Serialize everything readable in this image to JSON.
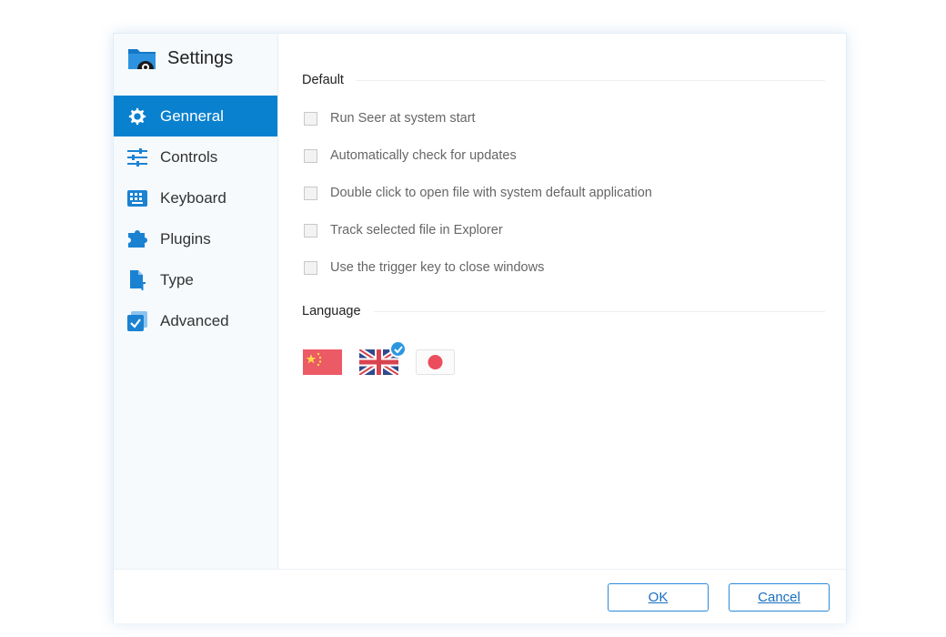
{
  "app": {
    "title": "Settings"
  },
  "sidebar": {
    "items": [
      {
        "label": "Genneral",
        "icon": "gear-icon",
        "active": true
      },
      {
        "label": "Controls",
        "icon": "sliders-icon",
        "active": false
      },
      {
        "label": "Keyboard",
        "icon": "keyboard-icon",
        "active": false
      },
      {
        "label": "Plugins",
        "icon": "puzzle-icon",
        "active": false
      },
      {
        "label": "Type",
        "icon": "file-type-icon",
        "active": false
      },
      {
        "label": "Advanced",
        "icon": "checkbox-stack-icon",
        "active": false
      }
    ]
  },
  "sections": {
    "default": {
      "title": "Default",
      "options": [
        {
          "label": "Run Seer at system start",
          "checked": false
        },
        {
          "label": "Automatically check for updates",
          "checked": false
        },
        {
          "label": "Double click to open file with system default application",
          "checked": false
        },
        {
          "label": "Track selected file in Explorer",
          "checked": false
        },
        {
          "label": "Use the trigger key to close windows",
          "checked": false
        }
      ]
    },
    "language": {
      "title": "Language",
      "flags": [
        {
          "icon": "china-flag-icon",
          "selected": false
        },
        {
          "icon": "uk-flag-icon",
          "selected": true
        },
        {
          "icon": "japan-flag-icon",
          "selected": false
        }
      ]
    }
  },
  "footer": {
    "ok_label": "OK",
    "cancel_label": "Cancel"
  },
  "colors": {
    "accent": "#0a81cf",
    "button_border": "#2b8ad8",
    "check_badge": "#2b97e0"
  }
}
